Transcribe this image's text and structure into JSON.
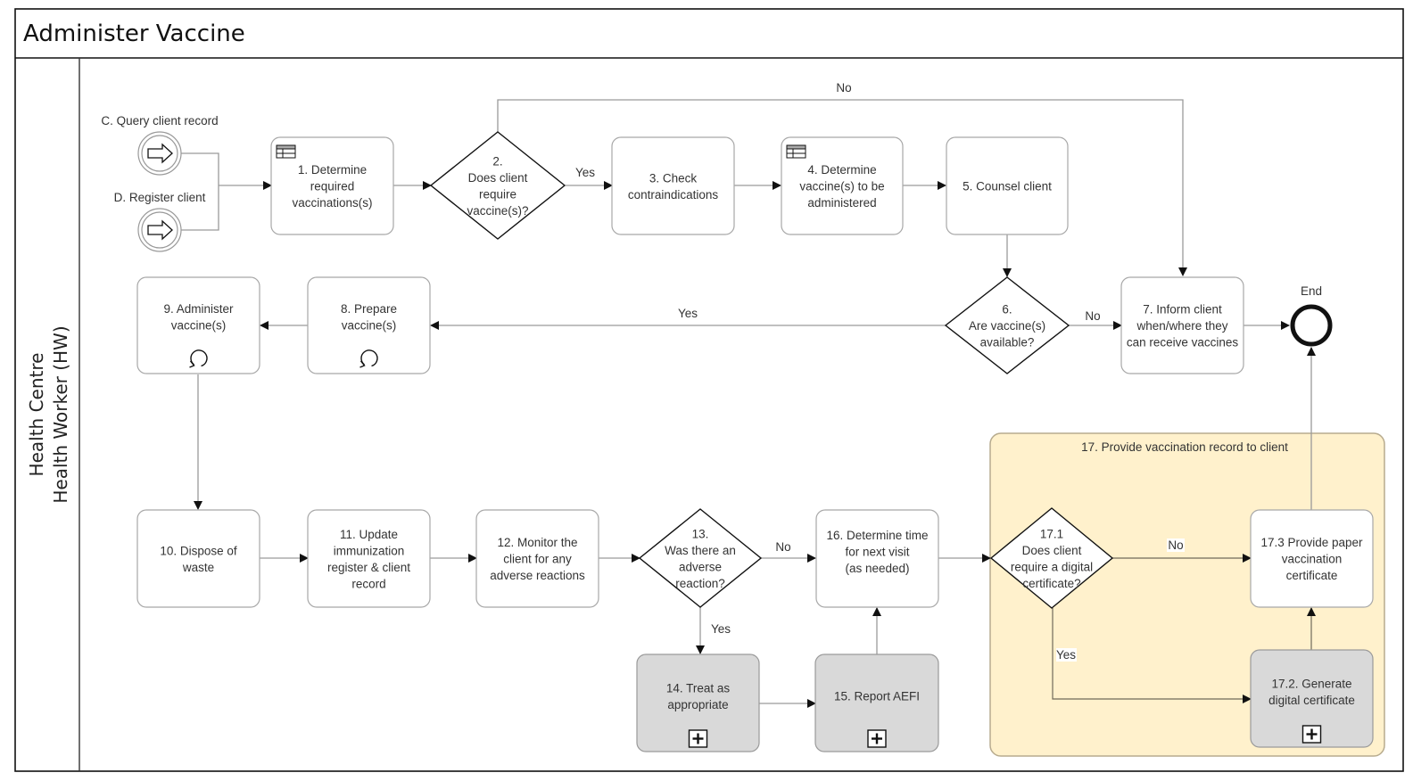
{
  "diagram": {
    "title": "Administer Vaccine",
    "lane": {
      "line1": "Health Centre",
      "line2": "Health Worker (HW)"
    },
    "colors": {
      "subprocess_fill": "#fff1cc",
      "collapsed_task_fill": "#d9d9d9",
      "task_fill": "#ffffff"
    },
    "start_events": [
      {
        "id": "C",
        "label": "C. Query client record",
        "icon": "link-arrow-icon"
      },
      {
        "id": "D",
        "label": "D. Register client",
        "icon": "link-arrow-icon"
      }
    ],
    "end_event": {
      "label": "End"
    },
    "tasks": {
      "t1": {
        "lines": [
          "1. Determine",
          "required",
          "vaccinations(s)"
        ],
        "marker": "business-rule-icon"
      },
      "t3": {
        "lines": [
          "3. Check",
          "contraindications"
        ]
      },
      "t4": {
        "lines": [
          "4. Determine",
          "vaccine(s) to be",
          "administered"
        ],
        "marker": "business-rule-icon"
      },
      "t5": {
        "lines": [
          "5. Counsel client"
        ]
      },
      "t7": {
        "lines": [
          "7. Inform client",
          "when/where they",
          "can receive vaccines"
        ]
      },
      "t8": {
        "lines": [
          "8. Prepare",
          "vaccine(s)"
        ],
        "marker": "loop-icon"
      },
      "t9": {
        "lines": [
          "9. Administer",
          "vaccine(s)"
        ],
        "marker": "loop-icon"
      },
      "t10": {
        "lines": [
          "10. Dispose of",
          "waste"
        ]
      },
      "t11": {
        "lines": [
          "11. Update",
          "immunization",
          "register & client",
          "record"
        ]
      },
      "t12": {
        "lines": [
          "12. Monitor the",
          "client for any",
          "adverse reactions"
        ]
      },
      "t14": {
        "lines": [
          "14. Treat as",
          "appropriate"
        ],
        "marker": "expand-plus-icon"
      },
      "t15": {
        "lines": [
          "15. Report AEFI"
        ],
        "marker": "expand-plus-icon"
      },
      "t16": {
        "lines": [
          "16. Determine time",
          "for next visit",
          "(as needed)"
        ]
      },
      "t172": {
        "lines": [
          "17.2. Generate",
          "digital certificate"
        ],
        "marker": "expand-plus-icon"
      },
      "t173": {
        "lines": [
          "17.3 Provide paper",
          "vaccination",
          "certificate"
        ]
      }
    },
    "gateways": {
      "g2": {
        "lines": [
          "2.",
          "Does client",
          "require",
          "vaccine(s)?"
        ]
      },
      "g6": {
        "lines": [
          "6.",
          "Are vaccine(s)",
          "available?"
        ]
      },
      "g13": {
        "lines": [
          "13.",
          "Was there an",
          "adverse",
          "reaction?"
        ]
      },
      "g171": {
        "lines": [
          "17.1",
          "Does client",
          "require a digital",
          "certificate?"
        ]
      }
    },
    "subprocess": {
      "label": "17. Provide vaccination record to client"
    },
    "edge_labels": {
      "g2_yes": "Yes",
      "g2_no": "No",
      "g6_yes": "Yes",
      "g6_no": "No",
      "g13_yes": "Yes",
      "g13_no": "No",
      "g171_no": "No",
      "g171_yes": "Yes"
    }
  }
}
